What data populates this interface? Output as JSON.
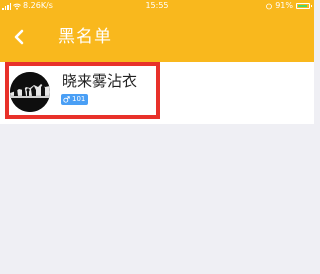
{
  "status_bar": {
    "network_speed": "8.26K/s",
    "time": "15:55",
    "battery_percent": "91%",
    "battery_level": 0.91
  },
  "nav": {
    "back_icon": "chevron-left-icon",
    "title": "黑名单"
  },
  "blacklist": [
    {
      "name": "晓来雾沾衣",
      "gender_icon": "male-icon",
      "badge_text": "101"
    }
  ],
  "colors": {
    "accent": "#f9b81d",
    "highlight": "#e8312a",
    "badge": "#4a9ff5"
  }
}
